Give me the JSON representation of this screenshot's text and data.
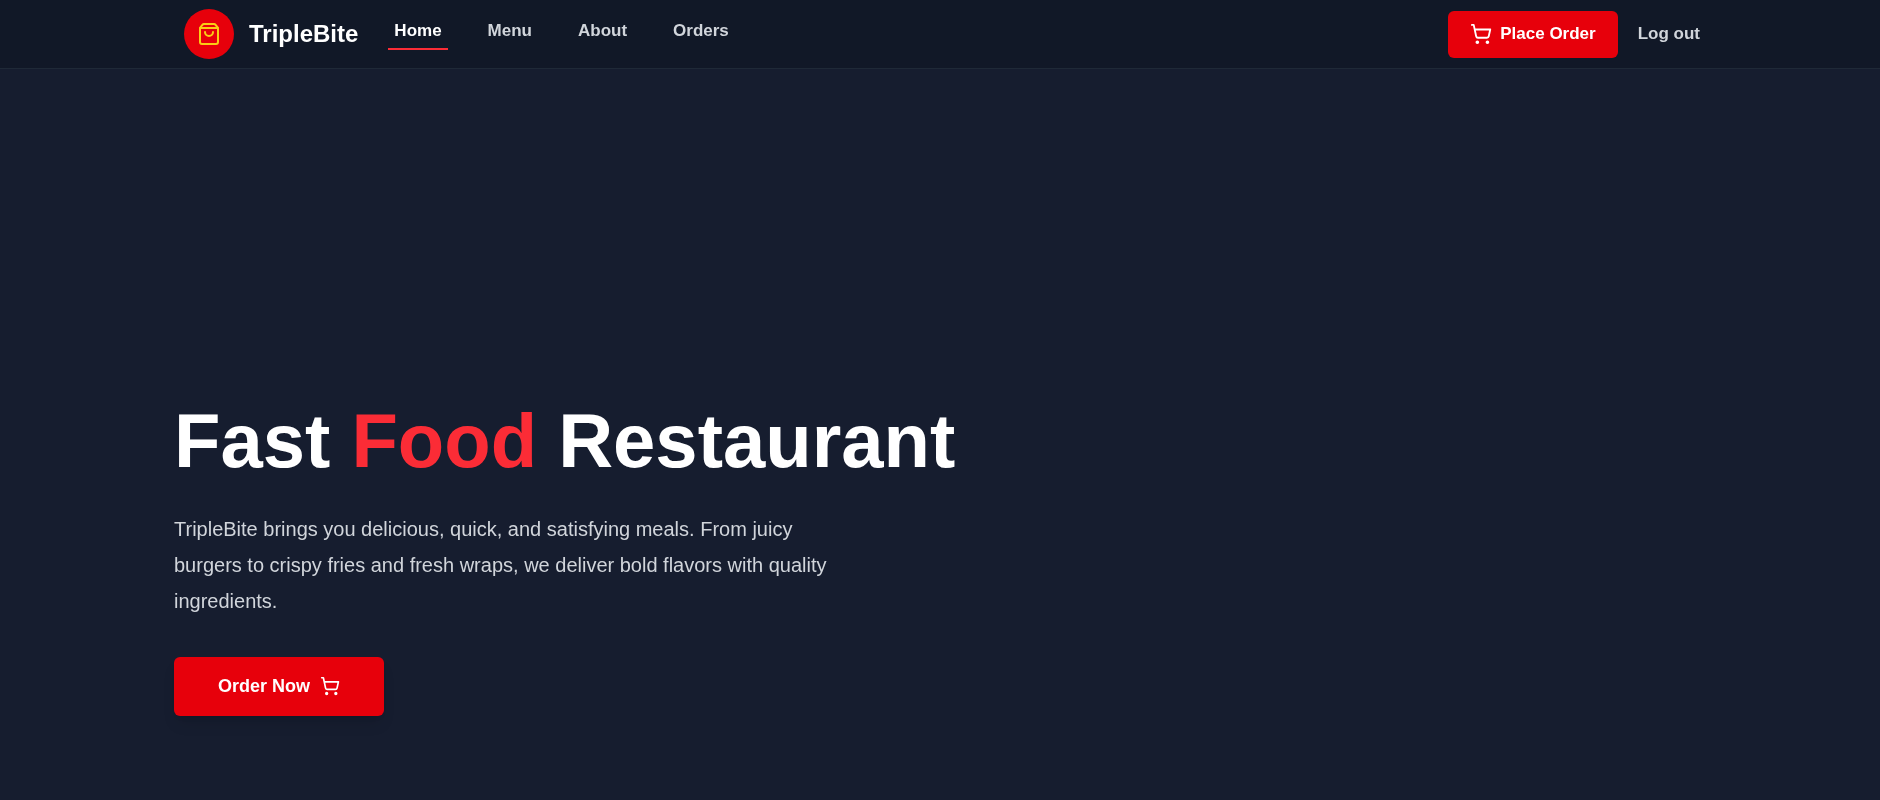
{
  "navbar": {
    "brand": "TripleBite",
    "links": [
      {
        "label": "Home",
        "selected": true
      },
      {
        "label": "Menu",
        "selected": false
      },
      {
        "label": "About",
        "selected": false
      },
      {
        "label": "Orders",
        "selected": false
      }
    ],
    "cta": "Place Order",
    "logout": "Log out"
  },
  "hero": {
    "title": [
      {
        "text": "Fast",
        "accent": false
      },
      {
        "text": "Food",
        "accent": true
      },
      {
        "text": "Restaurant",
        "accent": false
      }
    ],
    "description": "TripleBite brings you delicious, quick, and satisfying meals. From juicy burgers to crispy fries and fresh wraps, we deliver bold flavors with quality ingredients.",
    "button": "Order Now"
  }
}
